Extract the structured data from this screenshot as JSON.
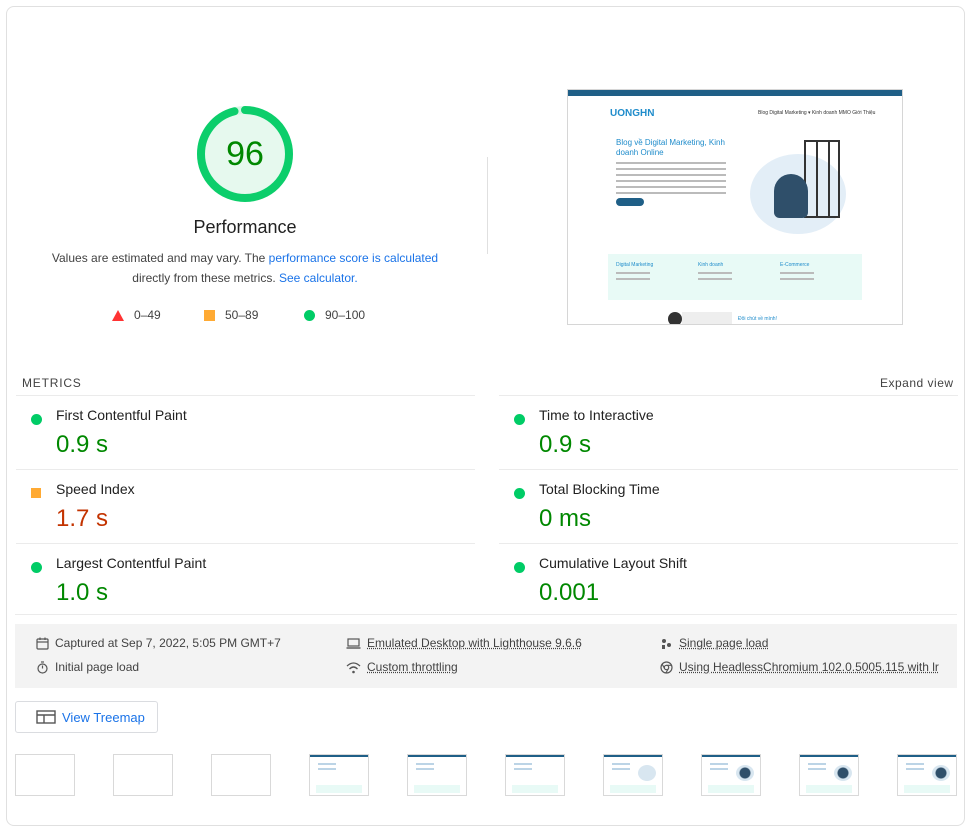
{
  "gauge": {
    "score": "96",
    "score_fraction": 0.96,
    "title": "Performance",
    "desc_prefix": "Values are estimated and may vary. The ",
    "desc_link1": "performance score is calculated",
    "desc_middle": "directly from these metrics. ",
    "desc_link2": "See calculator."
  },
  "legend": {
    "fail": "0–49",
    "average": "50–89",
    "pass": "90–100"
  },
  "thumbnail": {
    "logo": "UONGHN",
    "nav": "Blog   Digital Marketing ▾   Kinh doanh   MMO   Giới Thiệu",
    "hero_title": "Blog về Digital Marketing, Kinh doanh Online",
    "features": [
      "Digital Marketing",
      "Kinh doanh",
      "E-Commerce"
    ],
    "more_link": "Đôi chút về mình!"
  },
  "metrics": {
    "label": "METRICS",
    "expand": "Expand view",
    "items": [
      {
        "name": "First Contentful Paint",
        "value": "0.9 s",
        "status": "pass"
      },
      {
        "name": "Time to Interactive",
        "value": "0.9 s",
        "status": "pass"
      },
      {
        "name": "Speed Index",
        "value": "1.7 s",
        "status": "average"
      },
      {
        "name": "Total Blocking Time",
        "value": "0 ms",
        "status": "pass"
      },
      {
        "name": "Largest Contentful Paint",
        "value": "1.0 s",
        "status": "pass"
      },
      {
        "name": "Cumulative Layout Shift",
        "value": "0.001",
        "status": "pass"
      }
    ]
  },
  "runtime": {
    "captured": "Captured at Sep 7, 2022, 5:05 PM GMT+7",
    "emulated": "Emulated Desktop with Lighthouse 9.6.6",
    "single_page": "Single page load",
    "initial": "Initial page load",
    "throttling": "Custom throttling",
    "browser": "Using HeadlessChromium 102.0.5005.115 with lr"
  },
  "treemap": {
    "label": "View Treemap"
  },
  "colors": {
    "pass": "#0cce6b",
    "average": "#ffa400",
    "fail": "#ff4e42",
    "link": "#1a73e8"
  }
}
